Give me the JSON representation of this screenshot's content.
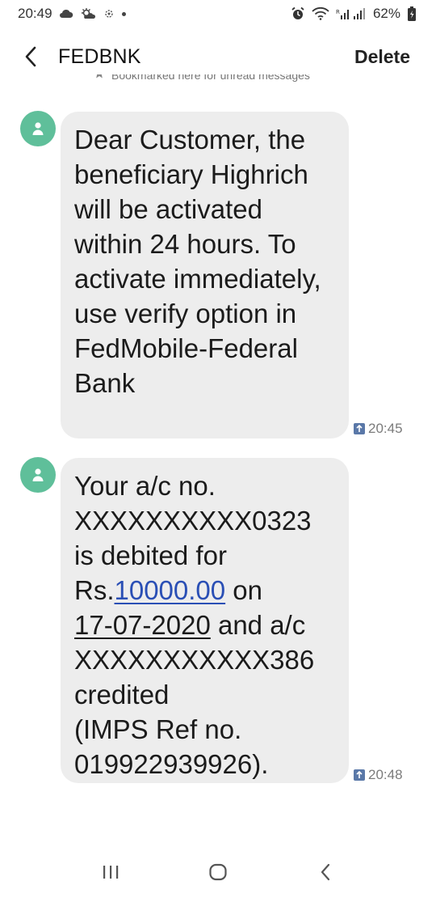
{
  "status_bar": {
    "time": "20:49",
    "battery": "62%",
    "icons": [
      "cloud-icon",
      "sun-cloud-icon",
      "weather-icon",
      "dot-icon",
      "alarm-icon",
      "wifi-icon",
      "signal-icon",
      "battery-icon"
    ]
  },
  "header": {
    "title": "FEDBNK",
    "delete_label": "Delete"
  },
  "bookmark": {
    "text": "Bookmarked here for unread messages"
  },
  "messages": [
    {
      "text": "Dear Customer, the beneficiary Highrich will be activated within 24 hours. To activate immediately, use verify option in FedMobile-Federal Bank",
      "time": "20:45"
    },
    {
      "text_parts": {
        "p1": "Your a/c no.",
        "p2": "XXXXXXXXXX0323",
        "p3": "is debited for",
        "p4": "Rs.",
        "amount": "10000.00",
        "p5": " on",
        "date": "17-07-2020",
        "p6": " and a/c",
        "p7": "XXXXXXXXXXX386",
        "p8": "credited",
        "p9": "(IMPS Ref no.",
        "p10": "019922939926)."
      },
      "time": "20:48"
    }
  ],
  "nav": {
    "items": [
      "recents-icon",
      "home-icon",
      "back-nav-icon"
    ]
  },
  "colors": {
    "avatar": "#5fbf9a",
    "bubble": "#ededed",
    "link": "#2a4fb5"
  }
}
